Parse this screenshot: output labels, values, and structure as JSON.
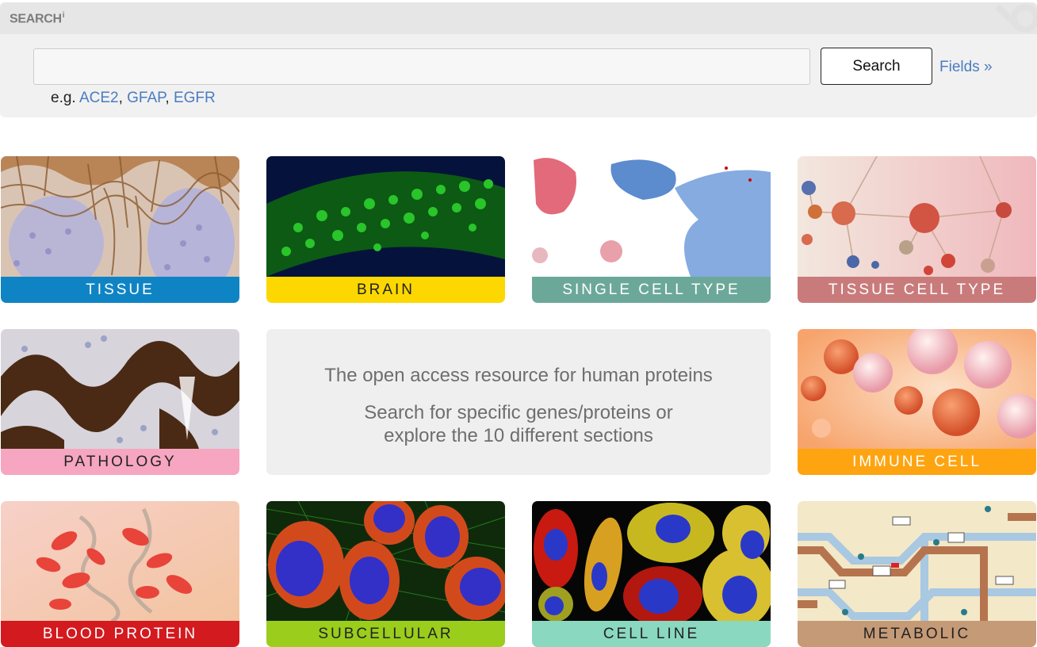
{
  "search": {
    "title": "SEARCH",
    "info_marker": "i",
    "placeholder": "",
    "value": "",
    "button_label": "Search",
    "fields_link": "Fields »",
    "example_prefix": "e.g.",
    "examples": [
      "ACE2",
      "GFAP",
      "EGFR"
    ]
  },
  "info": {
    "line1": "The open access resource for human proteins",
    "line2": "Search for specific genes/proteins or",
    "line3": "explore the 10 different sections"
  },
  "tiles": [
    {
      "label": "TISSUE",
      "color": "#0f84c4"
    },
    {
      "label": "BRAIN",
      "color": "#fcd800"
    },
    {
      "label": "SINGLE CELL TYPE",
      "color": "#6ca899"
    },
    {
      "label": "TISSUE CELL TYPE",
      "color": "#c97b7b"
    },
    {
      "label": "PATHOLOGY",
      "color": "#f6a6c0"
    },
    {
      "label": "IMMUNE CELL",
      "color": "#fea410"
    },
    {
      "label": "BLOOD PROTEIN",
      "color": "#d31a1f"
    },
    {
      "label": "SUBCELLULAR",
      "color": "#9acd1c"
    },
    {
      "label": "CELL LINE",
      "color": "#8ad8c0"
    },
    {
      "label": "METABOLIC",
      "color": "#c59a76"
    }
  ]
}
